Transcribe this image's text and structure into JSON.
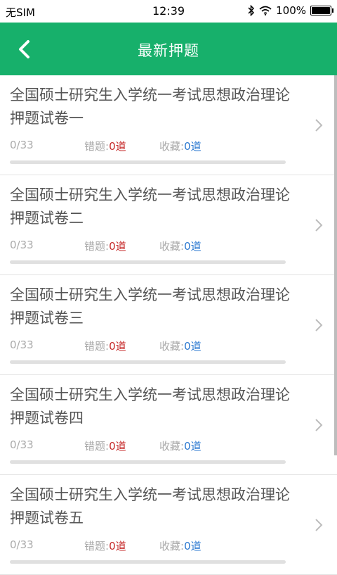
{
  "status_bar": {
    "carrier": "无SIM",
    "time": "12:39",
    "battery": "100%",
    "battery_level": 1.0
  },
  "header": {
    "title": "最新押题",
    "back_icon": "chevron-left-icon"
  },
  "items": [
    {
      "title": "全国硕士研究生入学统一考试思想政治理论押题试卷一",
      "progress": "0/33",
      "wrong_label": "错题:",
      "wrong_count": "0道",
      "fav_label": "收藏:",
      "fav_count": "0道",
      "progress_fraction": 0
    },
    {
      "title": "全国硕士研究生入学统一考试思想政治理论押题试卷二",
      "progress": "0/33",
      "wrong_label": "错题:",
      "wrong_count": "0道",
      "fav_label": "收藏:",
      "fav_count": "0道",
      "progress_fraction": 0
    },
    {
      "title": "全国硕士研究生入学统一考试思想政治理论押题试卷三",
      "progress": "0/33",
      "wrong_label": "错题:",
      "wrong_count": "0道",
      "fav_label": "收藏:",
      "fav_count": "0道",
      "progress_fraction": 0
    },
    {
      "title": "全国硕士研究生入学统一考试思想政治理论押题试卷四",
      "progress": "0/33",
      "wrong_label": "错题:",
      "wrong_count": "0道",
      "fav_label": "收藏:",
      "fav_count": "0道",
      "progress_fraction": 0
    },
    {
      "title": "全国硕士研究生入学统一考试思想政治理论押题试卷五",
      "progress": "0/33",
      "wrong_label": "错题:",
      "wrong_count": "0道",
      "fav_label": "收藏:",
      "fav_count": "0道",
      "progress_fraction": 0
    }
  ],
  "colors": {
    "header_bg": "#17b06b",
    "wrong_count": "#c62828",
    "fav_count": "#2b78d0"
  }
}
